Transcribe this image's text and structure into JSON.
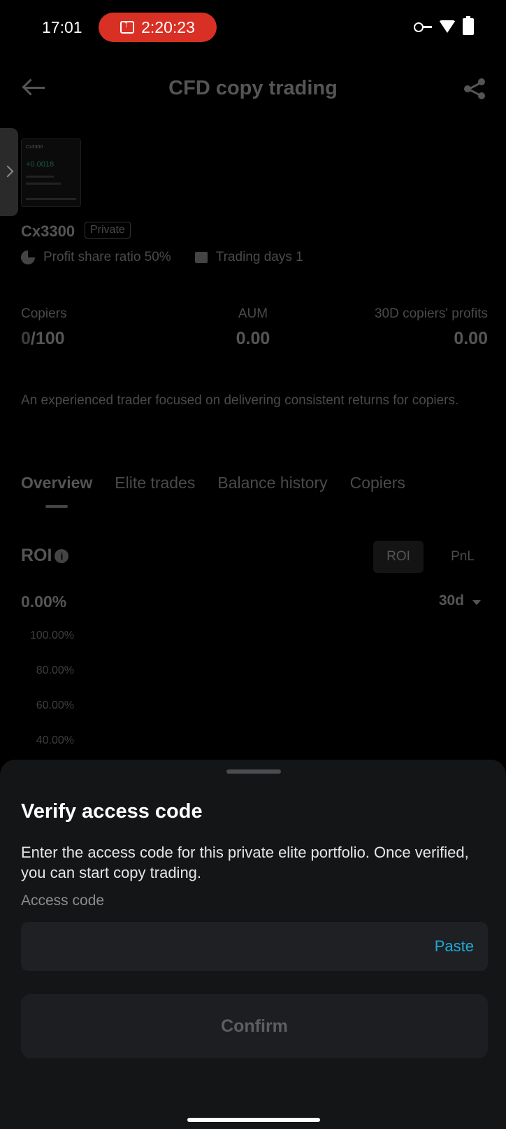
{
  "status_bar": {
    "time": "17:01",
    "recording_timer": "2:20:23",
    "recording_color": "#d93025"
  },
  "header": {
    "title": "CFD copy trading",
    "back_icon": "arrow-left-icon",
    "share_icon": "share-icon"
  },
  "thumbnail": {
    "heading": "Cx3300",
    "value": "+0.0018"
  },
  "trader": {
    "name": "Cx3300",
    "badge": "Private",
    "profit_share": "Profit share ratio 50%",
    "trading_days": "Trading days 1"
  },
  "stats": {
    "copiers_label": "Copiers",
    "copiers_current": "0",
    "copiers_max": "/100",
    "aum_label": "AUM",
    "aum_value": "0.00",
    "profits_label": "30D copiers' profits",
    "profits_value": "0.00"
  },
  "description": "An experienced trader focused on delivering consistent returns for copiers.",
  "tabs": [
    "Overview",
    "Elite trades",
    "Balance history",
    "Copiers"
  ],
  "chart_section": {
    "title": "ROI",
    "toggle_roi": "ROI",
    "toggle_pnl": "PnL",
    "value": "0.00%",
    "period": "30d",
    "y_ticks": [
      "100.00%",
      "80.00%",
      "60.00%",
      "40.00%"
    ]
  },
  "sheet": {
    "title": "Verify access code",
    "description": "Enter the access code for this private elite portfolio. Once verified, you can start copy trading.",
    "field_label": "Access code",
    "input_value": "",
    "paste_label": "Paste",
    "confirm_label": "Confirm",
    "accent_color": "#20a9d6"
  }
}
